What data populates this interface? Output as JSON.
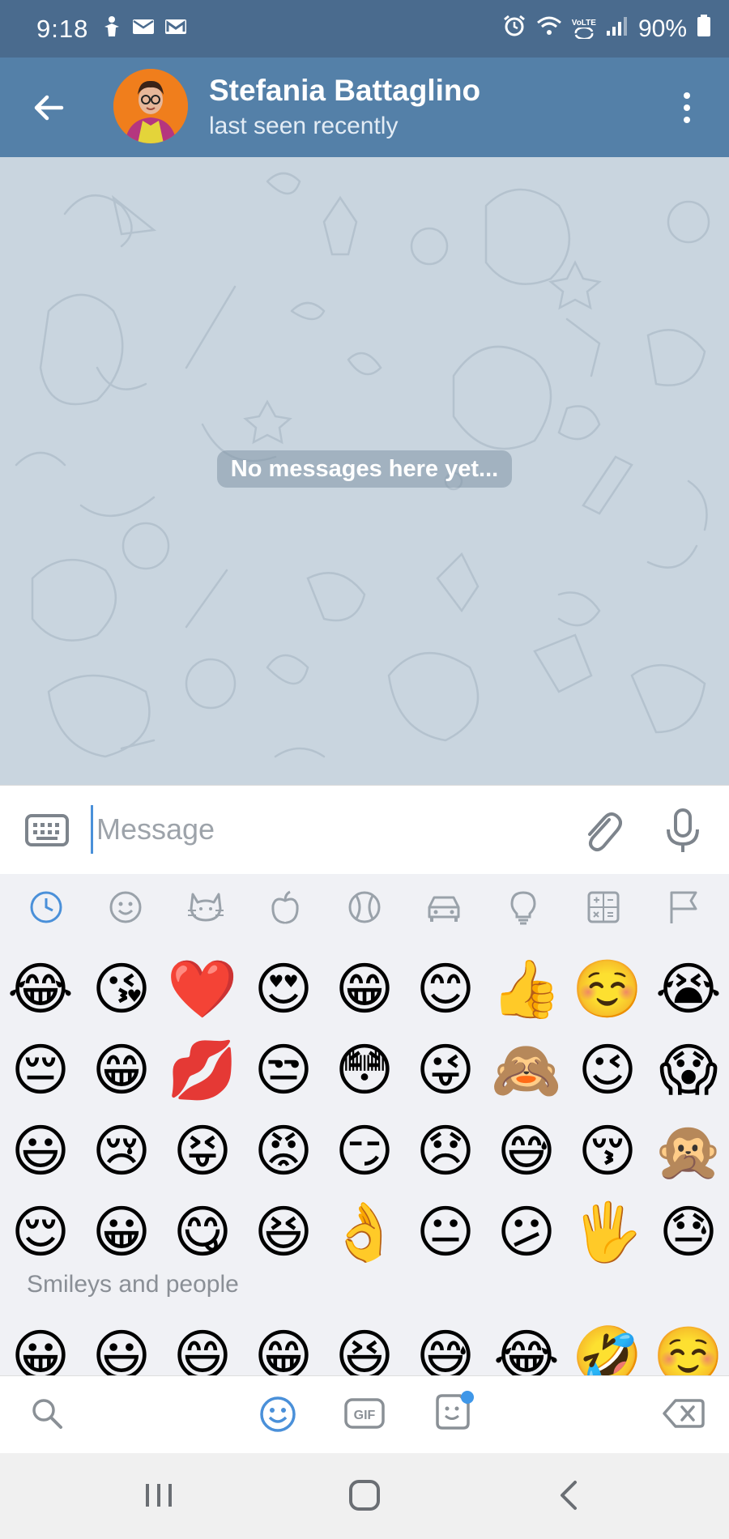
{
  "status_bar": {
    "time": "9:18",
    "battery": "90%",
    "volte": "VoLTE"
  },
  "header": {
    "name": "Stefania Battaglino",
    "status": "last seen recently"
  },
  "chat": {
    "empty_text": "No messages here yet..."
  },
  "input": {
    "placeholder": "Message",
    "value": ""
  },
  "emoji_categories": [
    "recent",
    "smileys",
    "animals",
    "food",
    "activity",
    "travel",
    "objects",
    "symbols",
    "flags"
  ],
  "recent_emojis": [
    [
      "😂",
      "😘",
      "❤️",
      "😍",
      "😁",
      "😊",
      "👍",
      "☺️",
      "😭"
    ],
    [
      "😔",
      "😁",
      "💋",
      "😒",
      "😳",
      "😜",
      "🙈",
      "😉",
      "😱"
    ],
    [
      "😃",
      "😢",
      "😝",
      "😡",
      "😏",
      "😞",
      "😅",
      "😚",
      "🙊"
    ],
    [
      "😌",
      "😀",
      "😋",
      "😆",
      "👌",
      "😐",
      "😕",
      "🖐️",
      "😓"
    ]
  ],
  "section_title": "Smileys and people",
  "smileys_row": [
    "😀",
    "😃",
    "😄",
    "😁",
    "😆",
    "😅",
    "😂",
    "🤣",
    "☺️"
  ],
  "colors": {
    "header": "#5480a8",
    "status_bar": "#4a6b8e",
    "accent": "#4a90d9",
    "chat_bg": "#c9d5df"
  }
}
